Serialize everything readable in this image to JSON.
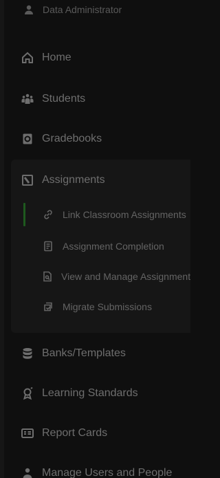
{
  "user": {
    "role": "Data Administrator",
    "icon": "user-icon"
  },
  "nav": {
    "home": {
      "label": "Home",
      "icon": "home-icon"
    },
    "students": {
      "label": "Students",
      "icon": "students-icon"
    },
    "gradebooks": {
      "label": "Gradebooks",
      "icon": "gradebook-icon"
    },
    "assignments": {
      "label": "Assignments",
      "icon": "assignments-icon",
      "children": [
        {
          "label": "Link Classroom Assignments",
          "icon": "link-icon",
          "active": true
        },
        {
          "label": "Assignment Completion",
          "icon": "document-icon"
        },
        {
          "label": "View and Manage Assignments",
          "icon": "view-document-icon"
        },
        {
          "label": "Migrate Submissions",
          "icon": "migrate-icon"
        }
      ]
    },
    "banks": {
      "label": "Banks/Templates",
      "icon": "database-icon"
    },
    "standards": {
      "label": "Learning Standards",
      "icon": "standards-icon"
    },
    "report_cards": {
      "label": "Report Cards",
      "icon": "report-card-icon"
    },
    "manage_users": {
      "label": "Manage Users and People",
      "icon": "manage-users-icon"
    }
  },
  "colors": {
    "background": "#0f0f0f",
    "panel": "#161616",
    "text": "#6e6e6e",
    "active_indicator": "#1e5a1e"
  }
}
